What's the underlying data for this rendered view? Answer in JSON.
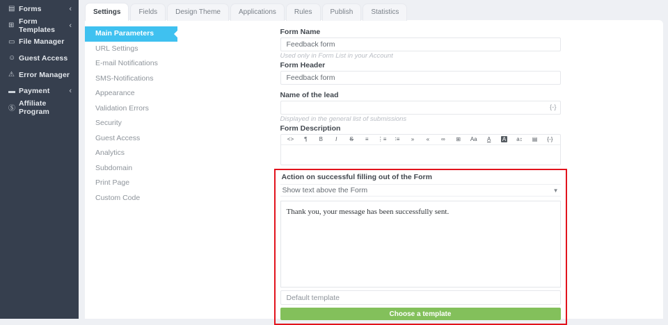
{
  "colors": {
    "sidebar_bg": "#363f4e",
    "accent_blue": "#3fc1f0",
    "highlight_red": "#e2121c",
    "button_green": "#83c05b",
    "page_bg": "#eef0f4"
  },
  "sidebar": {
    "items": [
      {
        "icon": "▤",
        "label": "Forms",
        "chevron": "‹"
      },
      {
        "icon": "⊞",
        "label": "Form Templates",
        "chevron": "‹"
      },
      {
        "icon": "▭",
        "label": "File Manager"
      },
      {
        "icon": "☺",
        "label": "Guest Access"
      },
      {
        "icon": "⚠",
        "label": "Error Manager"
      },
      {
        "icon": "▬",
        "label": "Payment",
        "chevron": "‹"
      },
      {
        "icon": "Ⓢ",
        "label": "Affiliate Program"
      }
    ]
  },
  "tabs": {
    "active": "Settings",
    "items": [
      "Settings",
      "Fields",
      "Design Theme",
      "Applications",
      "Rules",
      "Publish",
      "Statistics"
    ]
  },
  "subnav": {
    "active": "Main Parameters",
    "items": [
      "Main Parameters",
      "URL Settings",
      "E-mail Notifications",
      "SMS-Notifications",
      "Appearance",
      "Validation Errors",
      "Security",
      "Guest Access",
      "Analytics",
      "Subdomain",
      "Print Page",
      "Custom Code"
    ]
  },
  "form": {
    "form_name": {
      "label": "Form Name",
      "value": "Feedback form",
      "helper": "Used only in Form List in your Account"
    },
    "form_header": {
      "label": "Form Header",
      "value": "Feedback form"
    },
    "lead_name": {
      "label": "Name of the lead",
      "value": "",
      "variable_button": "{-}",
      "helper": "Displayed in the general list of submissions"
    },
    "description": {
      "label": "Form Description",
      "value": "",
      "toolbar": [
        {
          "name": "code",
          "glyph": "<>"
        },
        {
          "name": "paragraph",
          "glyph": "¶"
        },
        {
          "name": "bold",
          "glyph": "B"
        },
        {
          "name": "italic",
          "glyph": "I"
        },
        {
          "name": "strikethrough",
          "glyph": "S"
        },
        {
          "name": "align-left",
          "glyph": "≡"
        },
        {
          "name": "ordered-list",
          "glyph": "⋮≡"
        },
        {
          "name": "unordered-list",
          "glyph": "∶≡"
        },
        {
          "name": "indent",
          "glyph": "»"
        },
        {
          "name": "outdent",
          "glyph": "«"
        },
        {
          "name": "link",
          "glyph": "∞"
        },
        {
          "name": "table",
          "glyph": "⊞"
        },
        {
          "name": "font-size",
          "glyph": "Aa"
        },
        {
          "name": "text-color",
          "glyph": "A"
        },
        {
          "name": "background-color",
          "glyph": "A"
        },
        {
          "name": "line-height",
          "glyph": "a↕"
        },
        {
          "name": "image",
          "glyph": "▤"
        },
        {
          "name": "variable",
          "glyph": "{-}"
        }
      ]
    },
    "action_section": {
      "label": "Action on successful filling out of the Form",
      "select_value": "Show text above the Form",
      "select_chevron": "▼",
      "message": "Thank you, your message has been successfully sent.",
      "template_value": "Default template",
      "button_label": "Choose a template"
    }
  }
}
